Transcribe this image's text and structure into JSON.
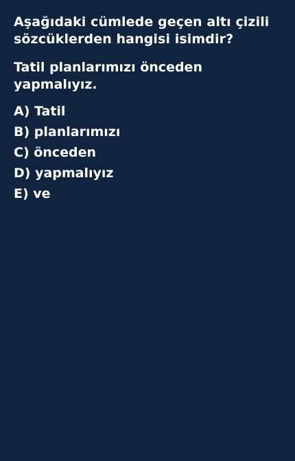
{
  "question": {
    "prompt": "Aşağıdaki cümlede geçen altı çizili sözcüklerden hangisi isimdir?",
    "sentence": "Tatil planlarımızı önceden yapmalıyız."
  },
  "options": [
    {
      "label": "A) Tatil"
    },
    {
      "label": "B) planlarımızı"
    },
    {
      "label": "C) önceden"
    },
    {
      "label": "D) yapmalıyız"
    },
    {
      "label": "E) ve"
    }
  ],
  "colors": {
    "background": "#10243f",
    "text": "#ffffff"
  }
}
